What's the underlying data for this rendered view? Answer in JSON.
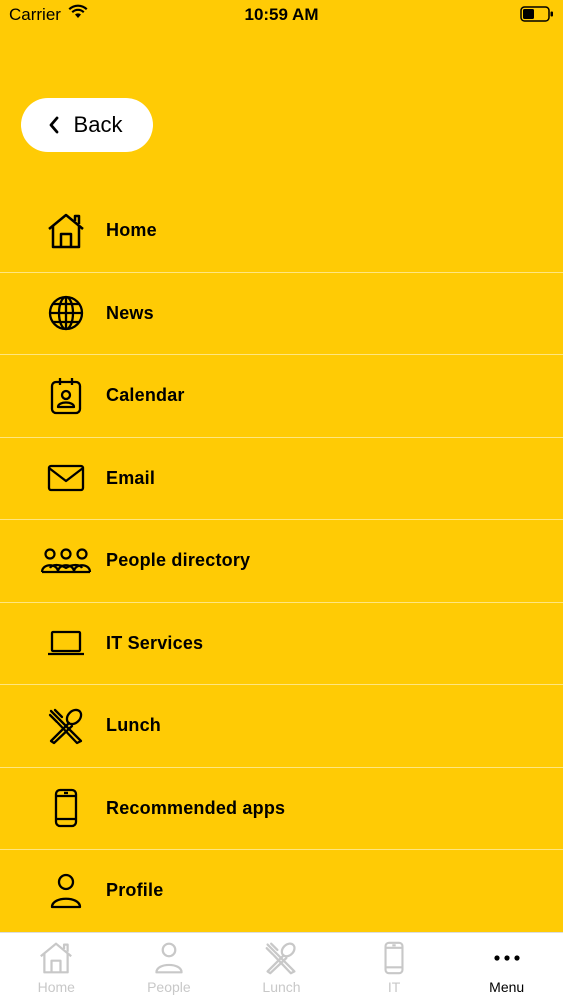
{
  "status_bar": {
    "carrier": "Carrier",
    "time": "10:59 AM"
  },
  "back_button": {
    "label": "Back"
  },
  "menu": {
    "items": [
      {
        "label": "Home",
        "icon": "home-icon"
      },
      {
        "label": "News",
        "icon": "globe-icon"
      },
      {
        "label": "Calendar",
        "icon": "calendar-badge-icon"
      },
      {
        "label": "Email",
        "icon": "envelope-icon"
      },
      {
        "label": "People directory",
        "icon": "people-icon"
      },
      {
        "label": "IT Services",
        "icon": "laptop-icon"
      },
      {
        "label": "Lunch",
        "icon": "utensils-icon"
      },
      {
        "label": "Recommended apps",
        "icon": "phone-icon"
      },
      {
        "label": "Profile",
        "icon": "user-icon"
      }
    ]
  },
  "tab_bar": {
    "tabs": [
      {
        "label": "Home",
        "icon": "home-icon",
        "active": false
      },
      {
        "label": "People",
        "icon": "person-icon",
        "active": false
      },
      {
        "label": "Lunch",
        "icon": "utensils-icon",
        "active": false
      },
      {
        "label": "IT",
        "icon": "phone-icon",
        "active": false
      },
      {
        "label": "Menu",
        "icon": "more-dots-icon",
        "active": true
      }
    ]
  },
  "colors": {
    "background": "#FFCB05",
    "divider": "#FFE680",
    "tab_inactive": "#C8C8C8",
    "tab_active": "#000000"
  }
}
